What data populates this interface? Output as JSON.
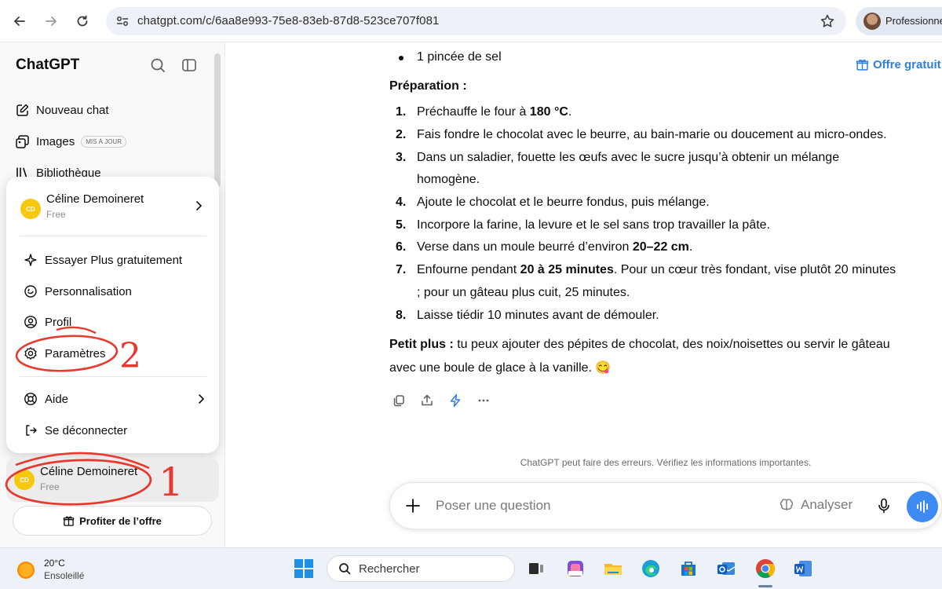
{
  "browser": {
    "url": "chatgpt.com/c/6aa8e993-75e8-83eb-87d8-523ce707f081",
    "profile_label": "Professionne"
  },
  "sidebar": {
    "title": "ChatGPT",
    "items": [
      {
        "label": "Nouveau chat",
        "icon": "edit-icon"
      },
      {
        "label": "Images",
        "icon": "images-icon",
        "badge": "MIS À JOUR"
      },
      {
        "label": "Bibliothèque",
        "icon": "library-icon"
      }
    ],
    "upgrade_button": "Profiter de l’offre"
  },
  "user": {
    "name": "Céline Demoineret",
    "plan": "Free",
    "initials": "CD",
    "avatar_color": "#f6c90e"
  },
  "profile_menu": {
    "items": [
      {
        "label": "Essayer Plus gratuitement",
        "icon": "sparkle-icon"
      },
      {
        "label": "Personnalisation",
        "icon": "personalization-icon"
      },
      {
        "label": "Profil",
        "icon": "profile-icon"
      },
      {
        "label": "Paramètres",
        "icon": "settings-icon"
      },
      {
        "label": "Aide",
        "icon": "help-icon"
      },
      {
        "label": "Se déconnecter",
        "icon": "logout-icon"
      }
    ]
  },
  "annotations": {
    "step1": "1",
    "step2": "2",
    "color": "#e8392f"
  },
  "chat": {
    "offer_link": "Offre gratuit",
    "bullet": "1 pincée de sel",
    "prep_heading": "Préparation :",
    "steps": [
      {
        "num": "1.",
        "lines": [
          {
            "a": "Préchauffe le four à ",
            "b": "180 °C",
            "c": "."
          }
        ]
      },
      {
        "num": "2.",
        "lines": [
          {
            "a": "Fais fondre le chocolat avec le beurre, au bain-marie ou doucement au micro-ondes."
          }
        ]
      },
      {
        "num": "3.",
        "lines": [
          {
            "a": "Dans un saladier, fouette les œufs avec le sucre jusqu’à obtenir un mélange"
          },
          {
            "a": "homogène."
          }
        ]
      },
      {
        "num": "4.",
        "lines": [
          {
            "a": "Ajoute le chocolat et le beurre fondus, puis mélange."
          }
        ]
      },
      {
        "num": "5.",
        "lines": [
          {
            "a": "Incorpore la farine, la levure et le sel sans trop travailler la pâte."
          }
        ]
      },
      {
        "num": "6.",
        "lines": [
          {
            "a": "Verse dans un moule beurré d’environ ",
            "b": "20–22 cm",
            "c": "."
          }
        ]
      },
      {
        "num": "7.",
        "lines": [
          {
            "a": "Enfourne pendant ",
            "b": "20 à 25 minutes",
            "c": ". Pour un cœur très fondant, vise plutôt 20 minutes"
          },
          {
            "a": "; pour un gâteau plus cuit, 25 minutes."
          }
        ]
      },
      {
        "num": "8.",
        "lines": [
          {
            "a": "Laisse tiédir 10 minutes avant de démouler."
          }
        ]
      }
    ],
    "tip_label": "Petit plus :",
    "tip_line1": " tu peux ajouter des pépites de chocolat, des noix/noisettes ou servir le gâteau",
    "tip_line2": "avec une boule de glace à la vanille.",
    "tip_emoji": "😋",
    "disclaimer": "ChatGPT peut faire des erreurs. Vérifiez les informations importantes.",
    "composer_placeholder": "Poser une question",
    "analyze_label": "Analyser"
  },
  "taskbar": {
    "temperature": "20°C",
    "weather": "Ensoleillé",
    "search_label": "Rechercher"
  }
}
